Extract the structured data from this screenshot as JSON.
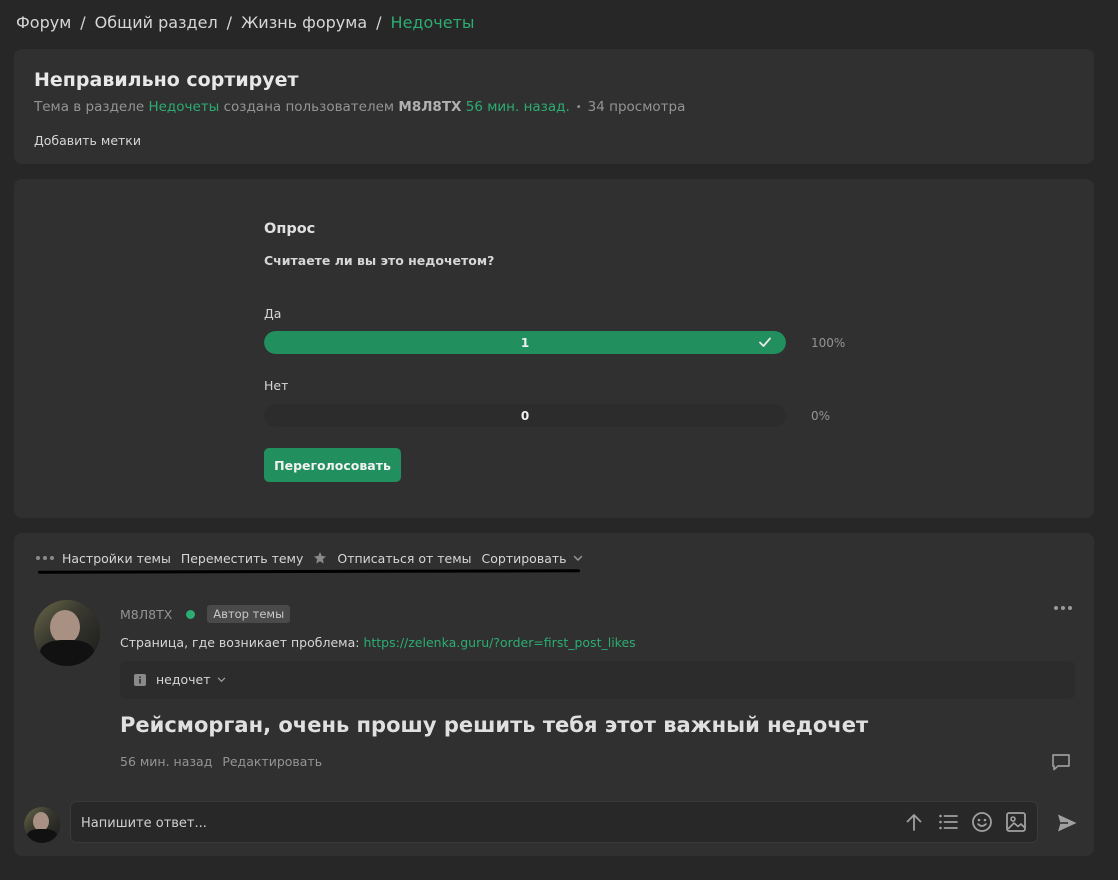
{
  "breadcrumb": {
    "items": [
      "Форум",
      "Общий раздел",
      "Жизнь форума"
    ],
    "current": "Недочеты",
    "separator": "/"
  },
  "thread": {
    "title": "Неправильно сортирует",
    "meta_prefix": "Тема в разделе",
    "meta_section": "Недочеты",
    "meta_created_by": "создана пользователем",
    "meta_author": "M8Л8TX",
    "meta_time": "56 мин. назад.",
    "meta_dot": "•",
    "meta_views": "34 просмотра",
    "add_tags": "Добавить метки"
  },
  "poll": {
    "title": "Опрос",
    "question": "Считаете ли вы это недочетом?",
    "options": [
      {
        "label": "Да",
        "count": "1",
        "percent": "100%",
        "fraction": 1.0,
        "voted": true
      },
      {
        "label": "Нет",
        "count": "0",
        "percent": "0%",
        "fraction": 0.0,
        "voted": false
      }
    ],
    "revote_label": "Переголосовать"
  },
  "toolbar": {
    "settings": "Настройки темы",
    "move": "Переместить тему",
    "unsubscribe": "Отписаться от темы",
    "sort": "Сортировать"
  },
  "post": {
    "author": "M8Л8TX",
    "badge": "Автор темы",
    "text_prefix": "Страница, где возникает проблема:",
    "link": "https://zelenka.guru/?order=first_post_likes",
    "tag": "недочет",
    "big_text": "Рейсморган, очень прошу решить тебя этот важный недочет",
    "time": "56 мин. назад",
    "edit": "Редактировать"
  },
  "reply": {
    "placeholder": "Напишите ответ..."
  },
  "colors": {
    "accent": "#2bad72",
    "button": "#21905e",
    "background": "#272727",
    "card": "#303030"
  }
}
